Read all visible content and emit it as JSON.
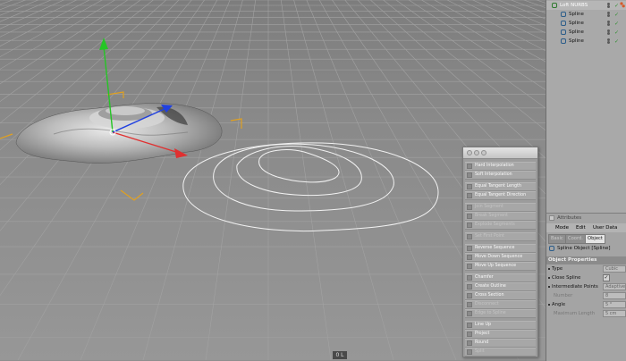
{
  "viewport": {
    "frame_label": "0 L"
  },
  "object_manager": {
    "parent": {
      "name": "Loft NURBS"
    },
    "children": [
      {
        "name": "Spline"
      },
      {
        "name": "Spline"
      },
      {
        "name": "Spline"
      },
      {
        "name": "Spline"
      }
    ]
  },
  "attributes": {
    "title": "Attributes",
    "menu": [
      "Mode",
      "Edit",
      "User Data"
    ],
    "tabs": [
      "Basic",
      "Coord.",
      "Object"
    ],
    "active_tab": "Object",
    "object_name": "Spline Object [Spline]",
    "section": "Object Properties",
    "props": {
      "type": {
        "label": "Type",
        "value": "Cubic"
      },
      "close_spline": {
        "label": "Close Spline"
      },
      "intermediate_points": {
        "label": "Intermediate Points",
        "value": "Adaptive"
      },
      "number": {
        "label": "Number",
        "value": "8"
      },
      "angle": {
        "label": "Angle",
        "value": "5 °"
      },
      "maximum_length": {
        "label": "Maximum Length",
        "value": "5 cm"
      }
    }
  },
  "palette": {
    "items": [
      {
        "label": "Hard Interpolation",
        "dim": false
      },
      {
        "label": "Soft Interpolation",
        "dim": false
      },
      {
        "label": "Equal Tangent Length",
        "dim": false
      },
      {
        "label": "Equal Tangent Direction",
        "dim": false
      },
      {
        "label": "Join Segment",
        "dim": true
      },
      {
        "label": "Break Segment",
        "dim": true
      },
      {
        "label": "Explode Segments",
        "dim": true
      },
      {
        "label": "Set First Point",
        "dim": true
      },
      {
        "label": "Reverse Sequence",
        "dim": false
      },
      {
        "label": "Move Down Sequence",
        "dim": false
      },
      {
        "label": "Move Up Sequence",
        "dim": false
      },
      {
        "label": "Chamfer",
        "dim": false
      },
      {
        "label": "Create Outline",
        "dim": false
      },
      {
        "label": "Cross Section",
        "dim": false
      },
      {
        "label": "Disconnect",
        "dim": true
      },
      {
        "label": "Edge to Spline",
        "dim": true
      },
      {
        "label": "Line Up",
        "dim": false
      },
      {
        "label": "Project",
        "dim": false
      },
      {
        "label": "Round",
        "dim": false
      },
      {
        "label": "Split",
        "dim": true
      }
    ]
  },
  "colors": {
    "axis_x": "#e03030",
    "axis_y": "#25c525",
    "axis_z": "#2040e0",
    "bounding_box": "#e0a020",
    "spline": "#f2f2f2"
  }
}
